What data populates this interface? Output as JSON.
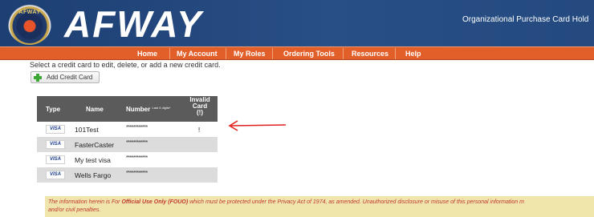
{
  "header": {
    "seal_text": "AFWAY",
    "brand": "AFWAY",
    "right_text": "Organizational Purchase Card Hold"
  },
  "nav": [
    {
      "label": "Home"
    },
    {
      "label": "My Account"
    },
    {
      "label": "My Roles"
    },
    {
      "label": "Ordering Tools"
    },
    {
      "label": "Resources"
    },
    {
      "label": "Help"
    }
  ],
  "instruction": "Select a credit card to edit, delete, or add a new credit card.",
  "add_button_label": "Add Credit Card",
  "table": {
    "headers": {
      "type": "Type",
      "name": "Name",
      "number": "Number",
      "number_note": "Last 4 digits*",
      "invalid_line1": "Invalid",
      "invalid_line2": "Card",
      "invalid_line3": "(!)"
    },
    "rows": [
      {
        "type": "VISA",
        "name": "101Test",
        "number": "************",
        "invalid": "!"
      },
      {
        "type": "VISA",
        "name": "FasterCaster",
        "number": "************",
        "invalid": ""
      },
      {
        "type": "VISA",
        "name": "My test visa",
        "number": "************",
        "invalid": ""
      },
      {
        "type": "VISA",
        "name": "Wells Fargo",
        "number": "************",
        "invalid": ""
      }
    ]
  },
  "notice": {
    "prefix": "The information herein is For ",
    "bold": "Official Use Only (FOUO)",
    "suffix": " which must be protected under the Privacy Act of 1974, as amended. Unauthorized disclosure or misuse of this personal information m",
    "line2": "and/or civil penalties."
  },
  "colors": {
    "banner": "#284f86",
    "navbar": "#e35f2a",
    "table_header": "#5b5b5b",
    "arrow": "#e02020",
    "notice_bg": "#f0e6ac",
    "notice_text": "#c0392b"
  }
}
